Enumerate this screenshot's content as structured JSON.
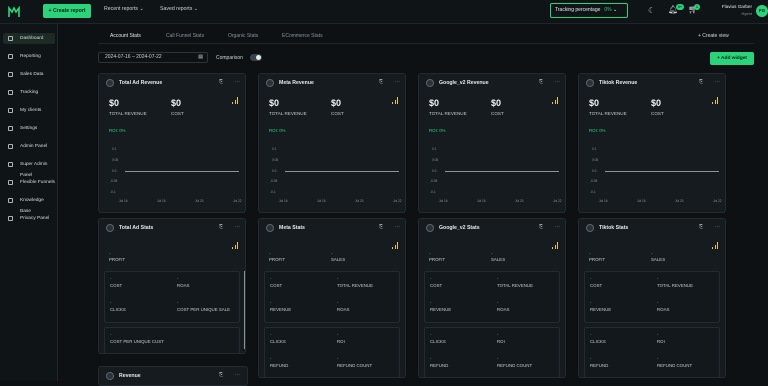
{
  "header": {
    "create_report": "+ Create report",
    "recent_reports": "Recent reports",
    "saved_reports": "Saved reports",
    "tracking_label": "Tracking percentage",
    "tracking_value": "0%",
    "notif_count": "0+",
    "cart_count": "1",
    "user_name": "Flavius Garber",
    "user_role": "Hyent",
    "avatar_initials": "FG"
  },
  "sidebar": {
    "items": [
      {
        "label": "Dashboard",
        "active": true
      },
      {
        "label": "Reporting"
      },
      {
        "label": "Sales Data"
      },
      {
        "label": "Tracking"
      },
      {
        "label": "My clients"
      },
      {
        "label": "Settings"
      },
      {
        "label": "Admin Panel"
      },
      {
        "label": "Super Admin Panel"
      },
      {
        "label": "Flexible Funnels"
      },
      {
        "label": "Knowledge Base"
      },
      {
        "label": "Privacy Panel"
      }
    ]
  },
  "tabs": [
    "Account Stats",
    "Call Funnel Stats",
    "Organic Stats",
    "ECommerce Stats"
  ],
  "create_view": "+ Create view",
  "date_range": "2024-07-16 – 2024-07-22",
  "comparison": "Comparison",
  "add_widget": "+ Add widget",
  "revenue_cards": [
    {
      "title": "Total Ad Revenue",
      "v1": "$0",
      "l1": "TOTAL REVENUE",
      "v2": "$0",
      "l2": "COST",
      "roi": "ROI: 0%"
    },
    {
      "title": "Meta Revenue",
      "v1": "$0",
      "l1": "TOTAL REVENUE",
      "v2": "$0",
      "l2": "COST",
      "roi": "ROI: 0%"
    },
    {
      "title": "Google_v2 Revenue",
      "v1": "$0",
      "l1": "TOTAL REVENUE",
      "v2": "$0",
      "l2": "COST",
      "roi": "ROI: 0%"
    },
    {
      "title": "Tiktok Revenue",
      "v1": "$0",
      "l1": "TOTAL REVENUE",
      "v2": "$0",
      "l2": "COST",
      "roi": "ROI: 0%"
    }
  ],
  "chart_data": {
    "type": "line",
    "x": [
      "Jul 16",
      "Jul 18",
      "Jul 20",
      "Jul 22"
    ],
    "series": [
      {
        "values": [
          0,
          0,
          0,
          0
        ]
      }
    ],
    "yticks": [
      "0.1",
      "0.05",
      "0.0",
      "-0.05",
      "-0.1"
    ],
    "ylim": [
      -0.1,
      0.1
    ]
  },
  "stats_cards": [
    {
      "title": "Total Ad Stats",
      "top": [
        "PROFIT",
        ""
      ],
      "rows": [
        [
          "COST",
          "ROAS"
        ],
        [
          "CLICKS",
          "COST PER UNIQUE SALE"
        ],
        [
          "COST PER UNIQUE CUST",
          ""
        ]
      ]
    },
    {
      "title": "Meta Stats",
      "top": [
        "PROFIT",
        "SALES"
      ],
      "rows": [
        [
          "COST",
          "TOTAL REVENUE"
        ],
        [
          "REVENUE",
          "ROAS"
        ],
        [
          "CLICKS",
          "ROI"
        ],
        [
          "REFUND",
          "REFUND COUNT"
        ]
      ]
    },
    {
      "title": "Google_v2 Stats",
      "top": [
        "PROFIT",
        "SALES"
      ],
      "rows": [
        [
          "COST",
          "TOTAL REVENUE"
        ],
        [
          "REVENUE",
          "ROAS"
        ],
        [
          "CLICKS",
          "ROI"
        ],
        [
          "REFUND",
          "REFUND COUNT"
        ]
      ]
    },
    {
      "title": "Tiktok Stats",
      "top": [
        "PROFIT",
        "SALES"
      ],
      "rows": [
        [
          "COST",
          "TOTAL REVENUE"
        ],
        [
          "REVENUE",
          "ROAS"
        ],
        [
          "CLICKS",
          "ROI"
        ],
        [
          "REFUND",
          "REFUND COUNT"
        ]
      ]
    }
  ],
  "bottom_card": {
    "title": "Revenue"
  },
  "dash": "-"
}
